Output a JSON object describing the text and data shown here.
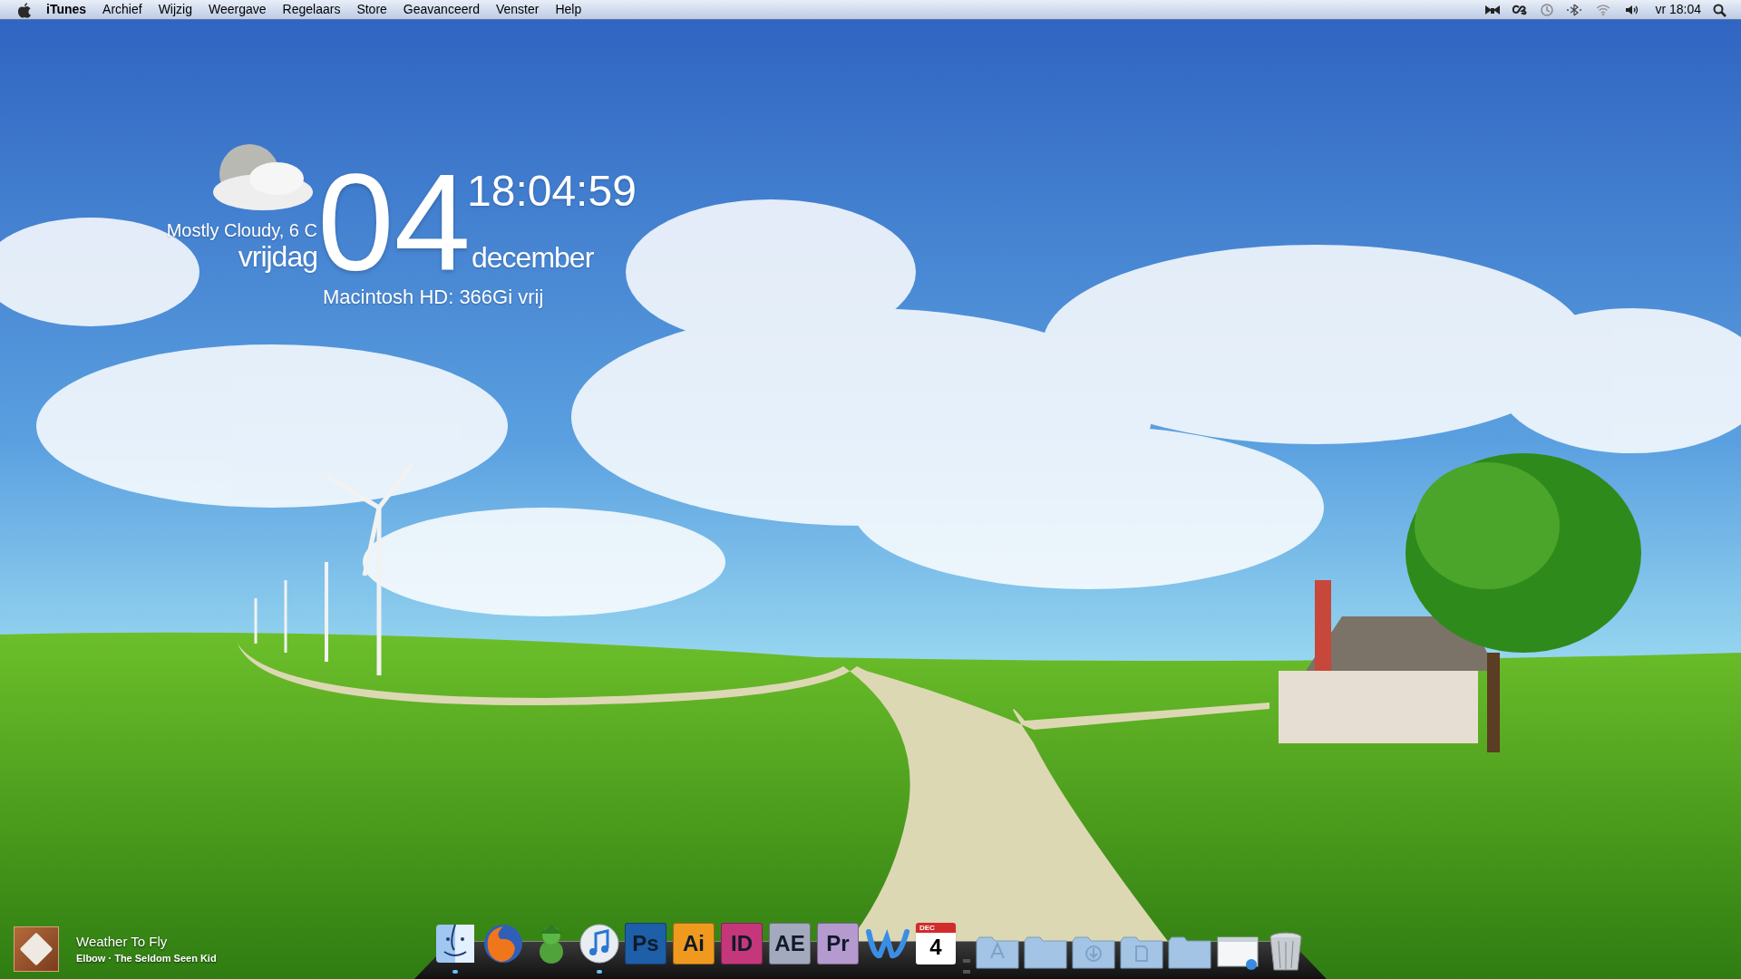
{
  "menubar": {
    "app_name": "iTunes",
    "menus": [
      "Archief",
      "Wijzig",
      "Weergave",
      "Regelaars",
      "Store",
      "Geavanceerd",
      "Venster",
      "Help"
    ],
    "clock": "vr 18:04"
  },
  "weather": {
    "condition": "Mostly Cloudy, 6 C"
  },
  "date_clock": {
    "day": "04",
    "time": "18:04:59",
    "weekday": "vrijdag",
    "month": "december"
  },
  "disk": {
    "text": "Macintosh HD: 366Gi vrij"
  },
  "now_playing": {
    "title": "Weather To Fly",
    "subtitle": "Elbow · The Seldom Seen Kid"
  },
  "dock": [
    {
      "kind": "finder",
      "running": true
    },
    {
      "kind": "firefox",
      "running": false
    },
    {
      "kind": "adium",
      "running": false
    },
    {
      "kind": "itunes",
      "running": true
    },
    {
      "kind": "badge",
      "label": "Ps",
      "color": "#1d5fa8",
      "running": false
    },
    {
      "kind": "badge",
      "label": "Ai",
      "color": "#ef9a1e",
      "running": false
    },
    {
      "kind": "badge",
      "label": "ID",
      "color": "#c4377a",
      "running": false
    },
    {
      "kind": "badge",
      "label": "AE",
      "color": "#a4aabd",
      "running": false
    },
    {
      "kind": "badge",
      "label": "Pr",
      "color": "#b59ad0",
      "running": false
    },
    {
      "kind": "word",
      "running": false
    },
    {
      "kind": "calendar",
      "month": "DEC",
      "day": "4",
      "running": false
    },
    {
      "kind": "separator"
    },
    {
      "kind": "folder-apps"
    },
    {
      "kind": "folder"
    },
    {
      "kind": "folder-downloads"
    },
    {
      "kind": "folder-documents"
    },
    {
      "kind": "folder"
    },
    {
      "kind": "preview"
    },
    {
      "kind": "trash"
    }
  ]
}
